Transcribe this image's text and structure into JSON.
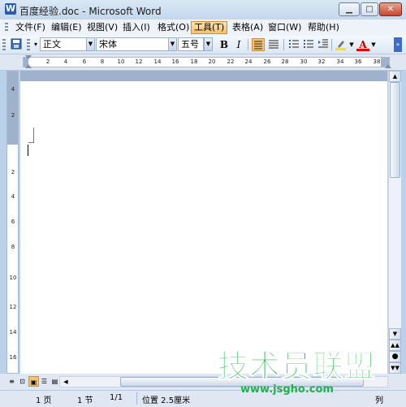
{
  "window": {
    "title": "百度经验.doc - Microsoft Word",
    "app_icon": "W"
  },
  "menu": {
    "items": [
      "文件(F)",
      "编辑(E)",
      "视图(V)",
      "插入(I)",
      "格式(O)",
      "工具(T)",
      "表格(A)",
      "窗口(W)",
      "帮助(H)"
    ],
    "active": "工具(T)"
  },
  "toolbar": {
    "style_value": "正文",
    "font_value": "宋体",
    "size_value": "五号",
    "bold_label": "B",
    "italic_label": "I",
    "font_color_label": "A"
  },
  "ruler": {
    "h_numbers": [
      "2",
      "4",
      "6",
      "8",
      "10",
      "12",
      "14",
      "16",
      "18",
      "20",
      "22",
      "24",
      "26",
      "28",
      "30",
      "32",
      "34",
      "36",
      "38"
    ],
    "v_numbers": [
      "4",
      "2",
      "2",
      "4",
      "6",
      "8",
      "10",
      "12",
      "14",
      "16"
    ],
    "tab_selector": "L"
  },
  "status": {
    "page": "1 页",
    "section": "1 节",
    "page_of": "1/1",
    "position": "位置 2.5厘米",
    "column": "列"
  },
  "watermark": {
    "text": "技术员联盟",
    "url": "www.jsgho.com"
  },
  "colors": {
    "accent": "#f8c16b",
    "watermark": "#23b14d"
  }
}
